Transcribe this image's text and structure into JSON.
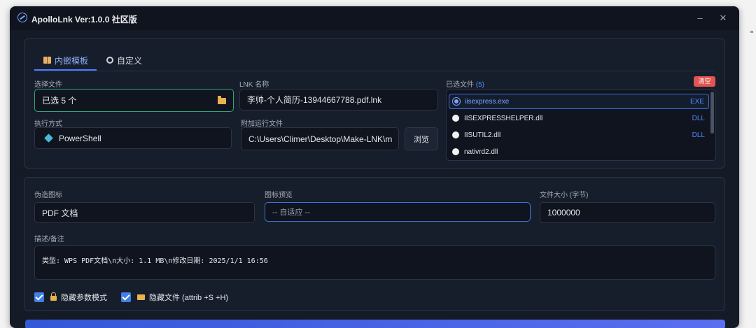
{
  "window": {
    "title": "ApolloLnk Ver:1.0.0 社区版",
    "minimize": "–",
    "close": "✕"
  },
  "tabs": [
    {
      "label": "内嵌模板",
      "active": true
    },
    {
      "label": "自定义",
      "active": false
    }
  ],
  "select_file": {
    "label": "选择文件",
    "value": "已选 5 个"
  },
  "lnk_name": {
    "label": "LNK 名称",
    "value": "李帅-个人简历-13944667788.pdf.lnk"
  },
  "exec_mode": {
    "label": "执行方式",
    "value": "PowerShell"
  },
  "extra_file": {
    "label": "附加运行文件",
    "value": "C:\\Users\\Climer\\Desktop\\Make-LNK\\m",
    "browse": "浏览"
  },
  "selected_files": {
    "label": "已选文件",
    "count": "(5)",
    "clear": "清空",
    "items": [
      {
        "name": "iisexpress.exe",
        "type": "EXE",
        "selected": true
      },
      {
        "name": "IISEXPRESSHELPER.dll",
        "type": "DLL",
        "selected": false
      },
      {
        "name": "IISUTIL2.dll",
        "type": "DLL",
        "selected": false
      },
      {
        "name": "nativrd2.dll",
        "type": "",
        "selected": false
      }
    ]
  },
  "fake_icon": {
    "label": "伪造图标",
    "value": "PDF 文档"
  },
  "icon_preview": {
    "label": "图标预览",
    "value": "-- 自适应 --"
  },
  "file_size": {
    "label": "文件大小 (字节)",
    "value": "1000000"
  },
  "description": {
    "label": "描述/备注",
    "value": "类型: WPS PDF文档\\n大小: 1.1 MB\\n修改日期: 2025/1/1 16:56"
  },
  "options": {
    "hide_params": {
      "label": "隐藏参数模式",
      "checked": true
    },
    "hide_file": {
      "label": "隐藏文件 (attrib +S +H)",
      "checked": true
    }
  },
  "colors": {
    "accent": "#4f7cff",
    "success_border": "#34a57f",
    "danger": "#e25452",
    "background": "#141a26"
  }
}
